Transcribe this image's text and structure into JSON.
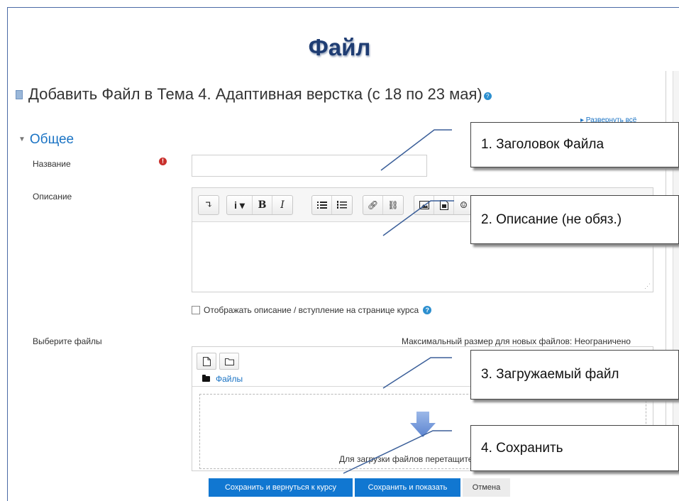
{
  "slide": {
    "title": "Файл"
  },
  "page": {
    "heading": "Добавить Файл в Тема 4. Адаптивная верстка (с 18 по 23 мая)",
    "expand_all": "▸ Развернуть всё"
  },
  "form": {
    "section_title": "Общее",
    "name_label": "Название",
    "name_value": "",
    "description_label": "Описание",
    "show_description_label": "Отображать описание / вступление на странице курса",
    "select_files_label": "Выберите файлы",
    "max_size_text": "Максимальный размер для новых файлов: Неограничено",
    "files_path": "Файлы",
    "drop_text": "Для загрузки файлов перетащите"
  },
  "editor": {
    "toolbar": [
      [
        "collapse-icon"
      ],
      [
        "paragraph-style-icon",
        "bold-icon",
        "italic-icon"
      ],
      [
        "unordered-list-icon",
        "ordered-list-icon"
      ],
      [
        "link-icon",
        "unlink-icon"
      ],
      [
        "image-icon",
        "media-icon",
        "emoji-icon",
        "more-icon"
      ]
    ]
  },
  "buttons": {
    "save_return": "Сохранить и вернуться к курсу",
    "save_display": "Сохранить и показать",
    "cancel": "Отмена"
  },
  "callouts": {
    "c1": "1. Заголовок Файла",
    "c2": "2. Описание (не обяз.)",
    "c3": "3. Загружаемый файл",
    "c4": "4. Сохранить"
  },
  "colors": {
    "link": "#1a73c4",
    "primary_button": "#1177d1",
    "required": "#c9302c",
    "title": "#1f3d73"
  }
}
